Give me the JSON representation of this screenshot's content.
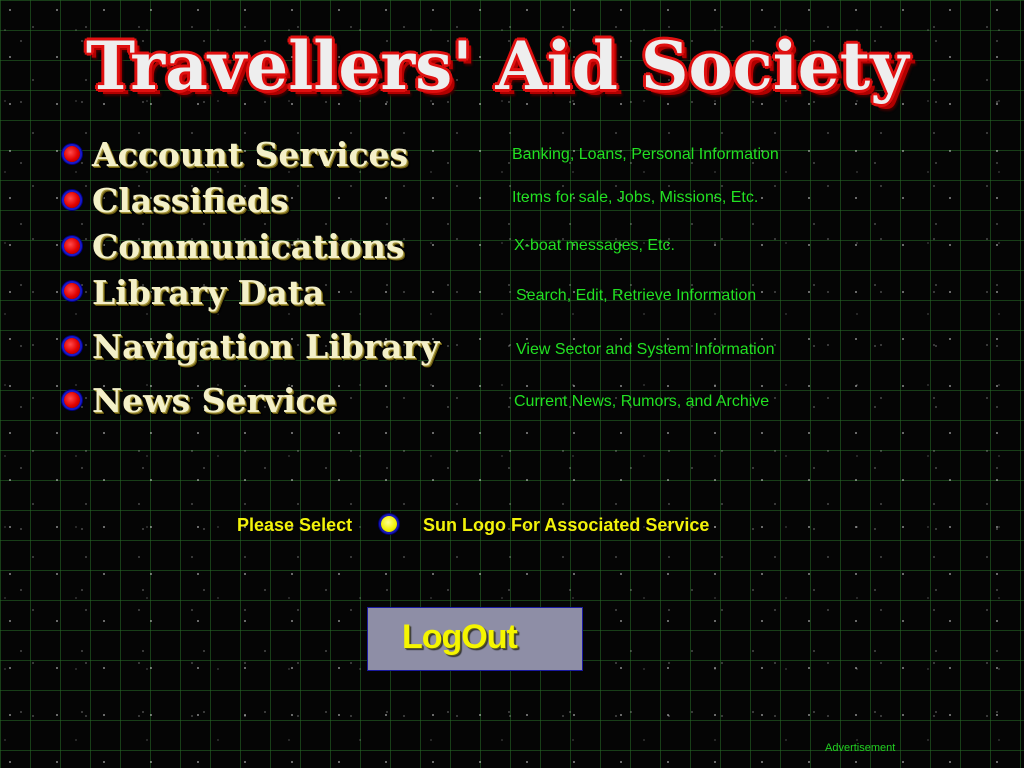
{
  "header": {
    "title": "Travellers' Aid Society"
  },
  "services": [
    {
      "label": "Account Services",
      "description": "Banking, Loans, Personal Information",
      "bullet_icon": "red-orb-icon"
    },
    {
      "label": "Classifieds",
      "description": "Items for sale, Jobs, Missions, Etc.",
      "bullet_icon": "red-orb-icon"
    },
    {
      "label": "Communications",
      "description": "X-boat messages, Etc.",
      "bullet_icon": "red-orb-icon"
    },
    {
      "label": "Library Data",
      "description": "Search, Edit, Retrieve Information",
      "bullet_icon": "red-orb-icon"
    },
    {
      "label": "Navigation Library",
      "description": "View Sector and System Information",
      "bullet_icon": "red-orb-icon"
    },
    {
      "label": "News Service",
      "description": "Current News, Rumors, and Archive",
      "bullet_icon": "red-orb-icon"
    }
  ],
  "instruction": {
    "prefix": "Please Select",
    "icon": "sun-logo-icon",
    "suffix": "Sun Logo For Associated Service"
  },
  "logout": {
    "label": "LogOut"
  },
  "footer": {
    "advertisement": "Advertisement"
  },
  "colors": {
    "background": "#050505",
    "grid": "#286e28",
    "title_fill": "#eeeeee",
    "title_outline": "#e01010",
    "service_text": "#f4f0c8",
    "description_text": "#22e022",
    "prompt_text": "#f2f20a",
    "bullet": "#e00000",
    "bullet_ring": "#1a1ac8",
    "sun": "#f0f000",
    "logout_background": "#8e8ea6",
    "logout_text": "#f5f500"
  }
}
